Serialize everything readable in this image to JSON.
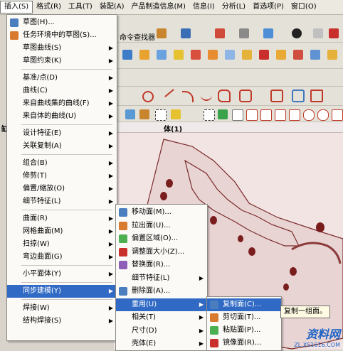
{
  "menubar": {
    "items": [
      {
        "label": "插入(S)",
        "active": true
      },
      {
        "label": "格式(R)"
      },
      {
        "label": "工具(T)"
      },
      {
        "label": "装配(A)"
      },
      {
        "label": "产品制造信息(M)"
      },
      {
        "label": "信息(I)"
      },
      {
        "label": "分析(L)"
      },
      {
        "label": "首选项(P)"
      },
      {
        "label": "窗口(O)"
      }
    ]
  },
  "toolbar": {
    "command_finder": "命令查找器"
  },
  "canvas": {
    "title": "体(1)",
    "left_fragment": "缸"
  },
  "insert_menu": {
    "items": [
      {
        "label": "草图(H)...",
        "icon": "sketch-icon"
      },
      {
        "label": "任务环境中的草图(S)...",
        "icon": "sketch-task-icon"
      },
      {
        "label": "草图曲线(S)",
        "submenu": true
      },
      {
        "label": "草图约束(K)",
        "submenu": true
      },
      {
        "sep": true
      },
      {
        "label": "基准/点(D)",
        "submenu": true
      },
      {
        "label": "曲线(C)",
        "submenu": true
      },
      {
        "label": "来自曲线集的曲线(F)",
        "submenu": true
      },
      {
        "label": "来自体的曲线(U)",
        "submenu": true
      },
      {
        "sep": true
      },
      {
        "label": "设计特征(E)",
        "submenu": true
      },
      {
        "label": "关联复制(A)",
        "submenu": true
      },
      {
        "sep": true
      },
      {
        "label": "组合(B)",
        "submenu": true
      },
      {
        "label": "修剪(T)",
        "submenu": true
      },
      {
        "label": "偏置/缩放(O)",
        "submenu": true
      },
      {
        "label": "细节特征(L)",
        "submenu": true
      },
      {
        "sep": true
      },
      {
        "label": "曲面(R)",
        "submenu": true
      },
      {
        "label": "网格曲面(M)",
        "submenu": true
      },
      {
        "label": "扫掠(W)",
        "submenu": true
      },
      {
        "label": "弯边曲面(G)",
        "submenu": true
      },
      {
        "sep": true
      },
      {
        "label": "小平面体(Y)",
        "submenu": true
      },
      {
        "sep": true
      },
      {
        "label": "同步建模(Y)",
        "submenu": true,
        "highlighted": true
      },
      {
        "sep": true
      },
      {
        "label": "焊接(W)",
        "submenu": true
      },
      {
        "label": "结构焊接(S)",
        "submenu": true
      }
    ]
  },
  "sync_menu": {
    "items": [
      {
        "label": "移动面(M)...",
        "icon": "move-face-icon"
      },
      {
        "label": "拉出面(U)...",
        "icon": "pull-face-icon"
      },
      {
        "label": "偏置区域(O)...",
        "icon": "offset-region-icon"
      },
      {
        "label": "调整面大小(Z)...",
        "icon": "resize-face-icon"
      },
      {
        "label": "替换面(R)...",
        "icon": "replace-face-icon"
      },
      {
        "label": "细节特征(L)",
        "submenu": true
      },
      {
        "label": "删除面(A)...",
        "icon": "delete-face-icon"
      },
      {
        "label": "重用(U)",
        "submenu": true,
        "highlighted": true
      },
      {
        "label": "相关(T)",
        "submenu": true
      },
      {
        "label": "尺寸(D)",
        "submenu": true
      },
      {
        "label": "壳体(E)",
        "submenu": true
      }
    ]
  },
  "reuse_menu": {
    "items": [
      {
        "label": "复制面(C)...",
        "icon": "copy-face-icon",
        "highlighted": true
      },
      {
        "label": "剪切面(T)...",
        "icon": "cut-face-icon"
      },
      {
        "label": "粘贴面(P)...",
        "icon": "paste-face-icon"
      },
      {
        "label": "镜像面(R)...",
        "icon": "mirror-face-icon"
      }
    ]
  },
  "tooltip": "复制一组面。",
  "watermark": {
    "main": "资料网",
    "sub": "ZL.XS1616.COM"
  }
}
